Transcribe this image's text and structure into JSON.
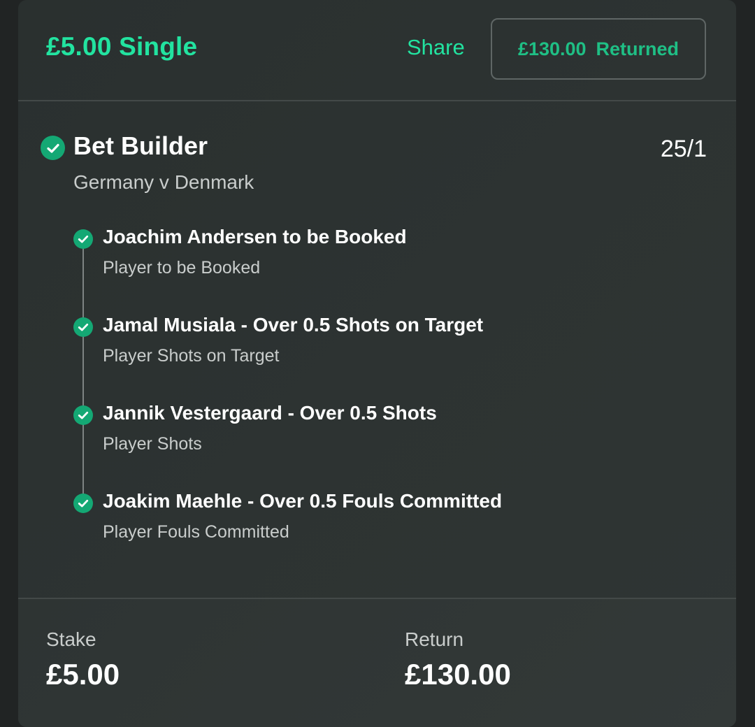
{
  "header": {
    "title": "£5.00 Single",
    "share_label": "Share",
    "returned_amount": "£130.00",
    "returned_label": "Returned"
  },
  "bet": {
    "type": "Bet Builder",
    "odds": "25/1",
    "event": "Germany v Denmark",
    "status_icon": "check-circle-icon",
    "legs": [
      {
        "title": "Joachim Andersen to be Booked",
        "market": "Player to be Booked"
      },
      {
        "title": "Jamal Musiala - Over 0.5 Shots on Target",
        "market": "Player Shots on Target"
      },
      {
        "title": "Jannik Vestergaard - Over 0.5 Shots",
        "market": "Player Shots"
      },
      {
        "title": "Joakim Maehle - Over 0.5 Fouls Committed",
        "market": "Player Fouls Committed"
      }
    ]
  },
  "footer": {
    "stake_label": "Stake",
    "stake_value": "£5.00",
    "return_label": "Return",
    "return_value": "£130.00"
  },
  "colors": {
    "accent": "#22e3a0",
    "success": "#14a874",
    "background": "#2d3332"
  }
}
